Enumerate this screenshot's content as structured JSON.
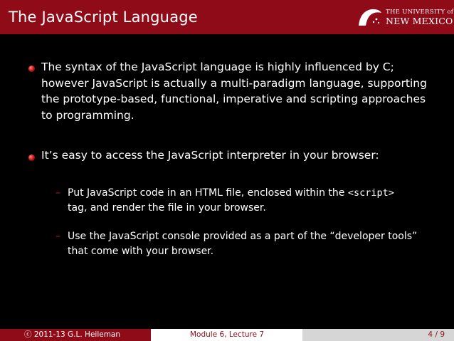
{
  "slide": {
    "title": "The JavaScript Language"
  },
  "logo": {
    "line1": "THE UNIVERSITY of",
    "line2": "NEW MEXICO"
  },
  "content": {
    "bullets": [
      {
        "lines": [
          "The syntax of the JavaScript language is highly influenced by C;",
          "however JavaScript is actually a multi-paradigm language, supporting",
          "the prototype-based, functional, imperative and scripting approaches",
          "to programming."
        ]
      },
      {
        "lines": [
          "It’s easy to access the JavaScript interpreter in your browser:"
        ],
        "subitems": [
          {
            "marker": "–",
            "line1_prefix": "Put JavaScript code in an HTML file, enclosed within the ",
            "line1_code": "<script>",
            "line2": "tag, and render the file in your browser."
          },
          {
            "marker": "–",
            "line1": "Use the JavaScript console provided as a part of the “developer tools”",
            "line2": "that come with your browser."
          }
        ]
      }
    ]
  },
  "footer": {
    "author": "ⓒ 2011-13 G.L. Heileman",
    "module": "Module 6, Lecture 7",
    "page": "4 / 9"
  },
  "colors": {
    "brand_red": "#8e0b17",
    "background": "#000000",
    "footer_gray": "#d6d6d6"
  }
}
